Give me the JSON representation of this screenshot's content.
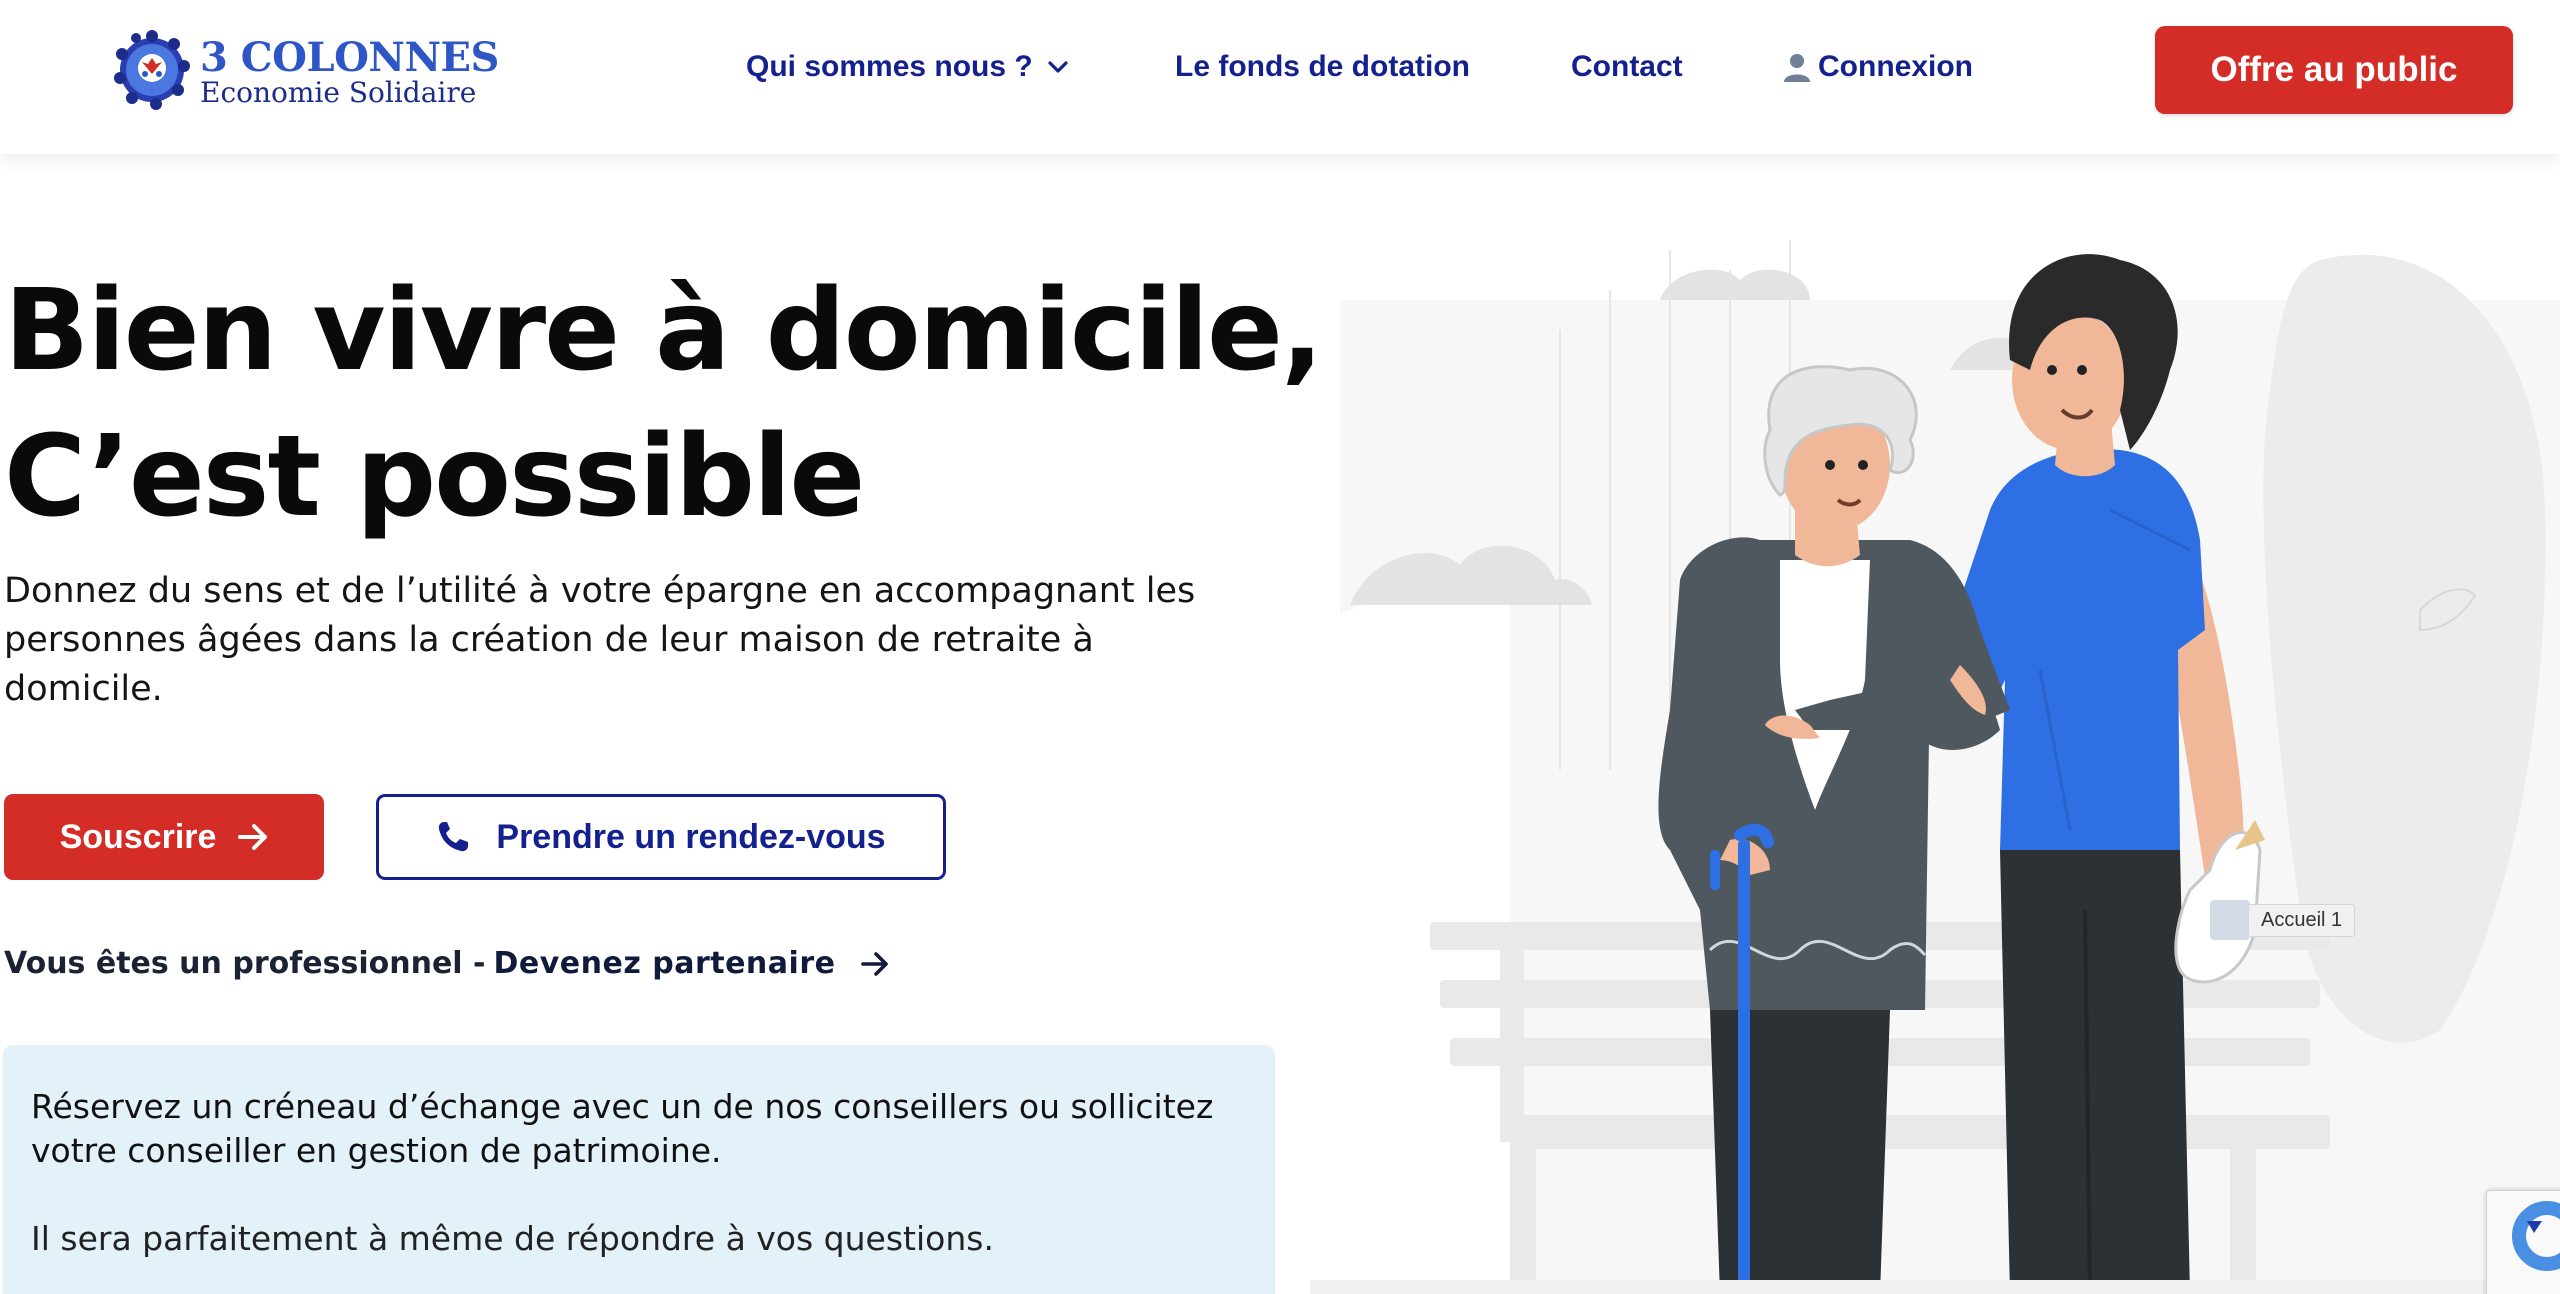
{
  "header": {
    "logo": {
      "title": "3 COLONNES",
      "subtitle": "Economie Solidaire"
    },
    "nav": {
      "about": {
        "label": "Qui sommes nous ?",
        "icon": "chevron-down-icon"
      },
      "fonds": {
        "label": "Le fonds de dotation"
      },
      "contact": {
        "label": "Contact"
      },
      "login": {
        "label": "Connexion",
        "icon": "user-icon"
      }
    },
    "cta": {
      "label": "Offre au public"
    }
  },
  "hero": {
    "title_line1": "Bien vivre à domicile,",
    "title_line2": "C’est possible",
    "description": "Donnez du sens et de l’utilité à votre épargne en accompagnant les personnes âgées dans la création de leur maison de retraite à domicile.",
    "subscribe_button": {
      "label": "Souscrire",
      "icon": "arrow-right-icon"
    },
    "appointment_button": {
      "label": "Prendre un rendez-vous",
      "icon": "phone-icon"
    },
    "pro_line": {
      "text": "Vous êtes un professionnel -",
      "link_label": "Devenez partenaire",
      "icon": "arrow-right-icon"
    }
  },
  "info_box": {
    "paragraph1": "Réservez un créneau d’échange avec un de nos conseillers ou sollicitez votre conseiller en gestion de patrimoine.",
    "paragraph2": "Il sera parfaitement à même de répondre à vos questions."
  },
  "illustration": {
    "tooltip": "Accueil 1",
    "subject": "elderly-woman-with-cane-and-young-man"
  },
  "colors": {
    "brand_red": "#d42d27",
    "brand_navy": "#14208e",
    "logo_blue": "#2f56c7",
    "info_bg": "#e3f1f9",
    "shirt_blue": "#2f6fe4"
  }
}
